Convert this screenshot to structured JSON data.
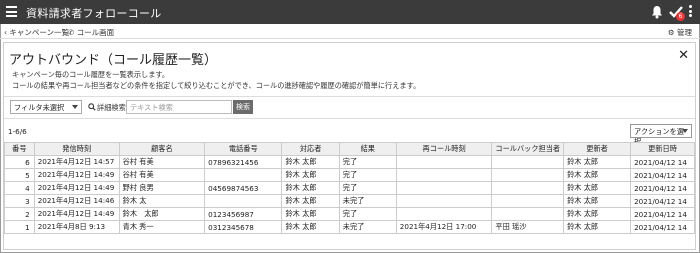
{
  "app": {
    "title": "資料請求者フォローコール",
    "badge_count": "6"
  },
  "subnav": {
    "back_label": "キャンペーン一覧",
    "call_label": "コール画面",
    "admin_label": "管理"
  },
  "panel": {
    "title": "アウトバウンド（コール履歴一覧）",
    "close": "✕",
    "desc1": "キャンペーン毎のコール履歴を一覧表示します。",
    "desc2": "コールの結果や再コール担当者などの条件を指定して絞り込むことができ、コールの進捗確認や履歴の確認が簡単に行えます。"
  },
  "filters": {
    "filter_select": "フィルタ未選択",
    "advanced_search": "詳細検索",
    "text_search_placeholder": "テキスト検索",
    "search_button": "検索"
  },
  "list": {
    "count": "1-6/6",
    "action_select": "アクションを選択"
  },
  "table": {
    "headers": [
      "番号",
      "発信時刻",
      "顧客名",
      "電話番号",
      "対応者",
      "結果",
      "再コール時刻",
      "コールバック担当者",
      "更新者",
      "更新日時"
    ],
    "rows": [
      [
        "6",
        "2021年4月12日 14:57",
        "谷村 有美",
        "07896321456",
        "鈴木 太郎",
        "完了",
        "",
        "",
        "鈴木 太郎",
        "2021/04/12 14"
      ],
      [
        "5",
        "2021年4月12日 14:49",
        "谷村 有美",
        "",
        "鈴木 太郎",
        "完了",
        "",
        "",
        "鈴木 太郎",
        "2021/04/12 14"
      ],
      [
        "4",
        "2021年4月12日 14:49",
        "野村 良男",
        "04569874563",
        "鈴木 太郎",
        "完了",
        "",
        "",
        "鈴木 太郎",
        "2021/04/12 14"
      ],
      [
        "3",
        "2021年4月12日 14:46",
        "鈴木 太",
        "",
        "鈴木 太郎",
        "未完了",
        "",
        "",
        "鈴木 太郎",
        "2021/04/12 14"
      ],
      [
        "2",
        "2021年4月12日 14:49",
        "鈴木　太郎",
        "0123456987",
        "鈴木 太郎",
        "完了",
        "",
        "",
        "鈴木 太郎",
        "2021/04/12 14"
      ],
      [
        "1",
        "2021年4月8日 9:13",
        "青木 秀一",
        "0312345678",
        "鈴木 太郎",
        "未完了",
        "2021年4月12日 17:00",
        "平田 瑶沙",
        "鈴木 太郎",
        "2021/04/12 14"
      ]
    ]
  },
  "icons": {
    "menu": "hamburger-icon",
    "bell": "bell-icon",
    "check": "checkmark-icon",
    "kebab": "more-vertical-icon"
  },
  "colors": {
    "topbar": "#3b3b3b",
    "badge": "#e33333",
    "search_button": "#6c6c6c"
  }
}
